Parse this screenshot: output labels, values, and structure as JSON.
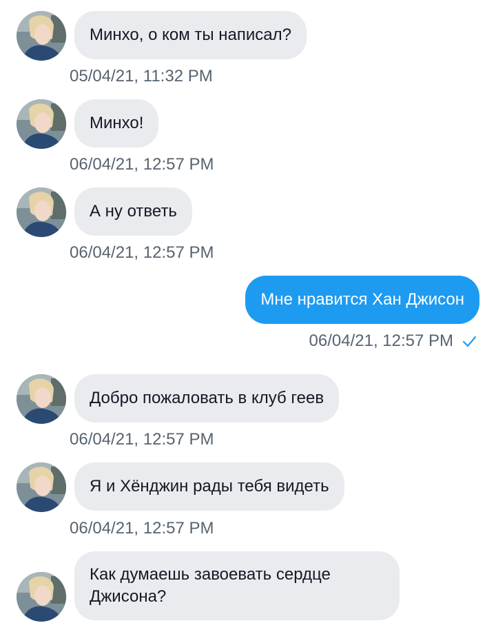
{
  "conversation": {
    "messages": [
      {
        "direction": "incoming",
        "text": "Минхо, о ком ты написал?",
        "timestamp": "05/04/21, 11:32 PM"
      },
      {
        "direction": "incoming",
        "text": "Минхо!",
        "timestamp": "06/04/21, 12:57 PM"
      },
      {
        "direction": "incoming",
        "text": "А ну ответь",
        "timestamp": "06/04/21, 12:57 PM"
      },
      {
        "direction": "outgoing",
        "text": "Мне нравится Хан Джисон",
        "timestamp": "06/04/21, 12:57 PM",
        "status_icon": "check-icon"
      },
      {
        "direction": "incoming",
        "text": "Добро пожаловать в клуб геев",
        "timestamp": "06/04/21, 12:57 PM"
      },
      {
        "direction": "incoming",
        "text": "Я и Хёнджин рады тебя видеть",
        "timestamp": "06/04/21, 12:57 PM"
      },
      {
        "direction": "incoming",
        "text": "Как думаешь завоевать сердце Джисона?",
        "timestamp": ""
      }
    ]
  },
  "colors": {
    "incoming_bubble": "#e9ebef",
    "outgoing_bubble": "#1d9bf0",
    "timestamp": "#566370",
    "check": "#1d9bf0"
  }
}
